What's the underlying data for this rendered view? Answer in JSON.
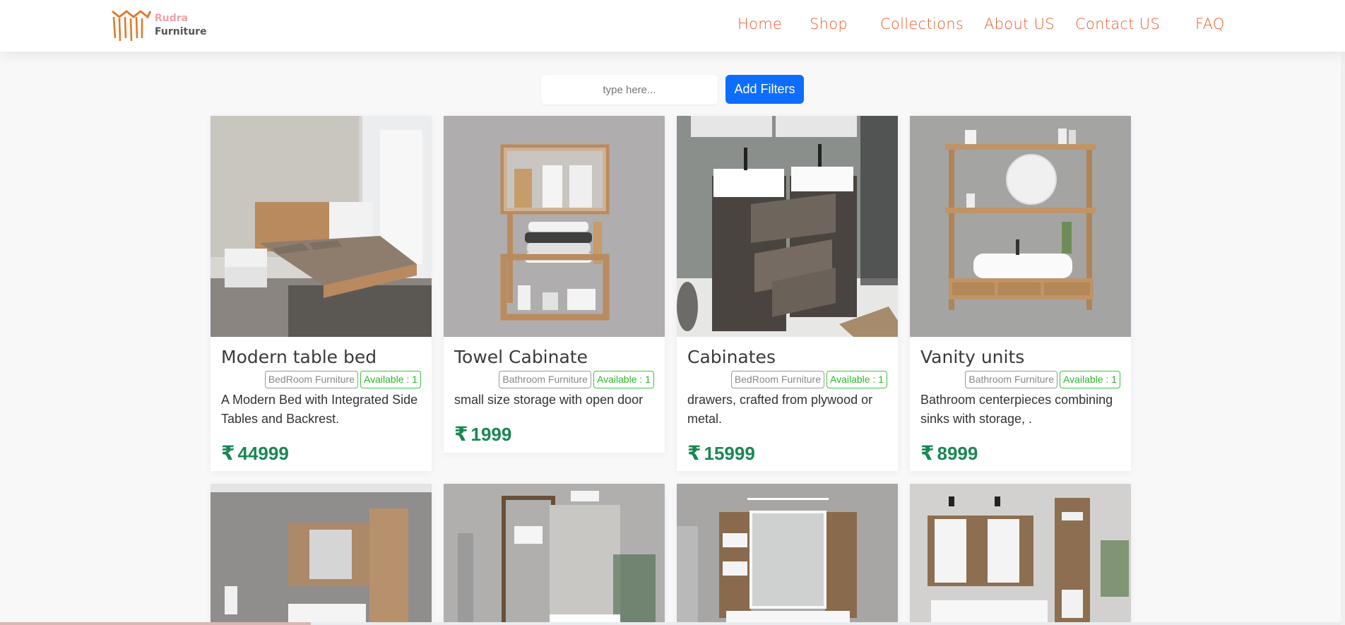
{
  "brand": {
    "line1": "Rudra",
    "line2": "Furniture"
  },
  "nav": [
    {
      "label": "Home",
      "name": "nav-home"
    },
    {
      "label": "Shop",
      "name": "nav-shop"
    },
    {
      "label": "Collections",
      "name": "nav-collections"
    },
    {
      "label": "About US",
      "name": "nav-about"
    },
    {
      "label": "Contact US",
      "name": "nav-contact"
    },
    {
      "label": "FAQ",
      "name": "nav-faq"
    }
  ],
  "search": {
    "placeholder": "type here...",
    "value": ""
  },
  "filter_button": "Add Filters",
  "currency": "₹",
  "products": [
    {
      "title": "Modern table bed",
      "category": "BedRoom Furniture",
      "availability": "Available : 1",
      "description": "A Modern Bed with Integrated Side Tables and Backrest.",
      "price": "44999"
    },
    {
      "title": "Towel Cabinate",
      "category": "Bathroom Furniture",
      "availability": "Available : 1",
      "description": "small size storage with open door",
      "price": "1999"
    },
    {
      "title": "Cabinates",
      "category": "BedRoom Furniture",
      "availability": "Available : 1",
      "description": "drawers, crafted from plywood or metal.",
      "price": "15999"
    },
    {
      "title": "Vanity units",
      "category": "Bathroom Furniture",
      "availability": "Available : 1",
      "description": "Bathroom centerpieces combining sinks with storage, .",
      "price": "8999"
    }
  ],
  "colors": {
    "nav": "#ee5a2c",
    "price": "#198754",
    "button": "#0d6efd",
    "available": "#2db52d"
  }
}
